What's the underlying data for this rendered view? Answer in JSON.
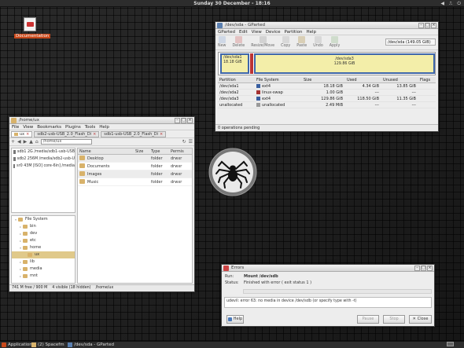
{
  "top_panel": {
    "clock": "Sunday 30 December - 18:16",
    "tray": [
      "◀",
      "⎍",
      "⏻"
    ]
  },
  "desktop": {
    "icon_label": "Documentation"
  },
  "taskbar": {
    "applications": "Applications",
    "items": [
      {
        "label": "(2) Spacefm"
      },
      {
        "label": "/dev/sda - GParted"
      }
    ]
  },
  "gparted": {
    "title": "/dev/sda - GParted",
    "menu": [
      "GParted",
      "Edit",
      "View",
      "Device",
      "Partition",
      "Help"
    ],
    "toolbar": [
      "New",
      "Delete",
      "Resize/Move",
      "Copy",
      "Paste",
      "Undo",
      "Apply"
    ],
    "device": "/dev/sda (149.05 GiB)",
    "visual": {
      "p1": {
        "name": "/dev/sda1",
        "size": "18.18 GiB"
      },
      "p3": {
        "name": "/dev/sda3",
        "size": "129.86 GiB"
      }
    },
    "columns": [
      "Partition",
      "File System",
      "Size",
      "Used",
      "Unused",
      "Flags"
    ],
    "rows": [
      {
        "partition": "/dev/sda1",
        "fs": "ext4",
        "fs_color": "#385ea0",
        "size": "18.18 GiB",
        "used": "4.34 GiB",
        "unused": "13.85 GiB",
        "flags": ""
      },
      {
        "partition": "/dev/sda2",
        "fs": "linux-swap",
        "fs_color": "#a53232",
        "size": "1.00 GiB",
        "used": "---",
        "unused": "---",
        "flags": ""
      },
      {
        "partition": "/dev/sda3",
        "fs": "ext4",
        "fs_color": "#385ea0",
        "size": "129.86 GiB",
        "used": "118.50 GiB",
        "unused": "11.35 GiB",
        "flags": ""
      },
      {
        "partition": "unallocated",
        "fs": "unallocated",
        "fs_color": "#9a9a9a",
        "size": "2.49 MiB",
        "used": "---",
        "unused": "---",
        "flags": ""
      }
    ],
    "status": "0 operations pending"
  },
  "file_manager": {
    "title": "/home/ux",
    "menu": [
      "File",
      "View",
      "Bookmarks",
      "Plugins",
      "Tools",
      "Help"
    ],
    "tabs": [
      "ux",
      "sdb2-usb-USB_2.0_Flash_Di",
      "sdb1-usb-USB_2.0_Flash_Di"
    ],
    "path": "/home/ux",
    "devices": [
      "sdb1 2G /media/sdb1-usb-USB",
      "sdb2 256M /media/sdb2-usb-U",
      "sr0 43M [ISO] core-6in] /media"
    ],
    "tree": [
      {
        "label": "File System",
        "expander": "▿",
        "indent": 0
      },
      {
        "label": "bin",
        "expander": "▹",
        "indent": 1
      },
      {
        "label": "dev",
        "expander": "▹",
        "indent": 1
      },
      {
        "label": "etc",
        "expander": "▹",
        "indent": 1
      },
      {
        "label": "home",
        "expander": "▿",
        "indent": 1
      },
      {
        "label": "ux",
        "expander": "",
        "indent": 2
      },
      {
        "label": "lib",
        "expander": "▹",
        "indent": 1
      },
      {
        "label": "media",
        "expander": "▹",
        "indent": 1
      },
      {
        "label": "mnt",
        "expander": "▹",
        "indent": 1
      }
    ],
    "columns": [
      "Name",
      "Size",
      "Type",
      "Permis"
    ],
    "files": [
      {
        "name": "Desktop",
        "size": "",
        "type": "folder",
        "perm": "drwxr"
      },
      {
        "name": "Documents",
        "size": "",
        "type": "folder",
        "perm": "drwxr"
      },
      {
        "name": "Images",
        "size": "",
        "type": "folder",
        "perm": "drwxr"
      },
      {
        "name": "Music",
        "size": "",
        "type": "folder",
        "perm": "drwxr"
      }
    ],
    "status": [
      "741 M free / 900 M",
      "4 visible (18 hidden)",
      "/home/ux"
    ]
  },
  "errors": {
    "title": "Errors",
    "run_label": "Run:",
    "run_value": "Mount /dev/sdb",
    "status_label": "Status:",
    "status_value": "Finished with error  ( exit status 1 )",
    "message": "udevil: error 63: no media in device /dev/sdb (or specify type with -t)",
    "buttons": {
      "help": "Help",
      "pause": "Pause",
      "stop": "Stop",
      "close": "Close"
    }
  }
}
